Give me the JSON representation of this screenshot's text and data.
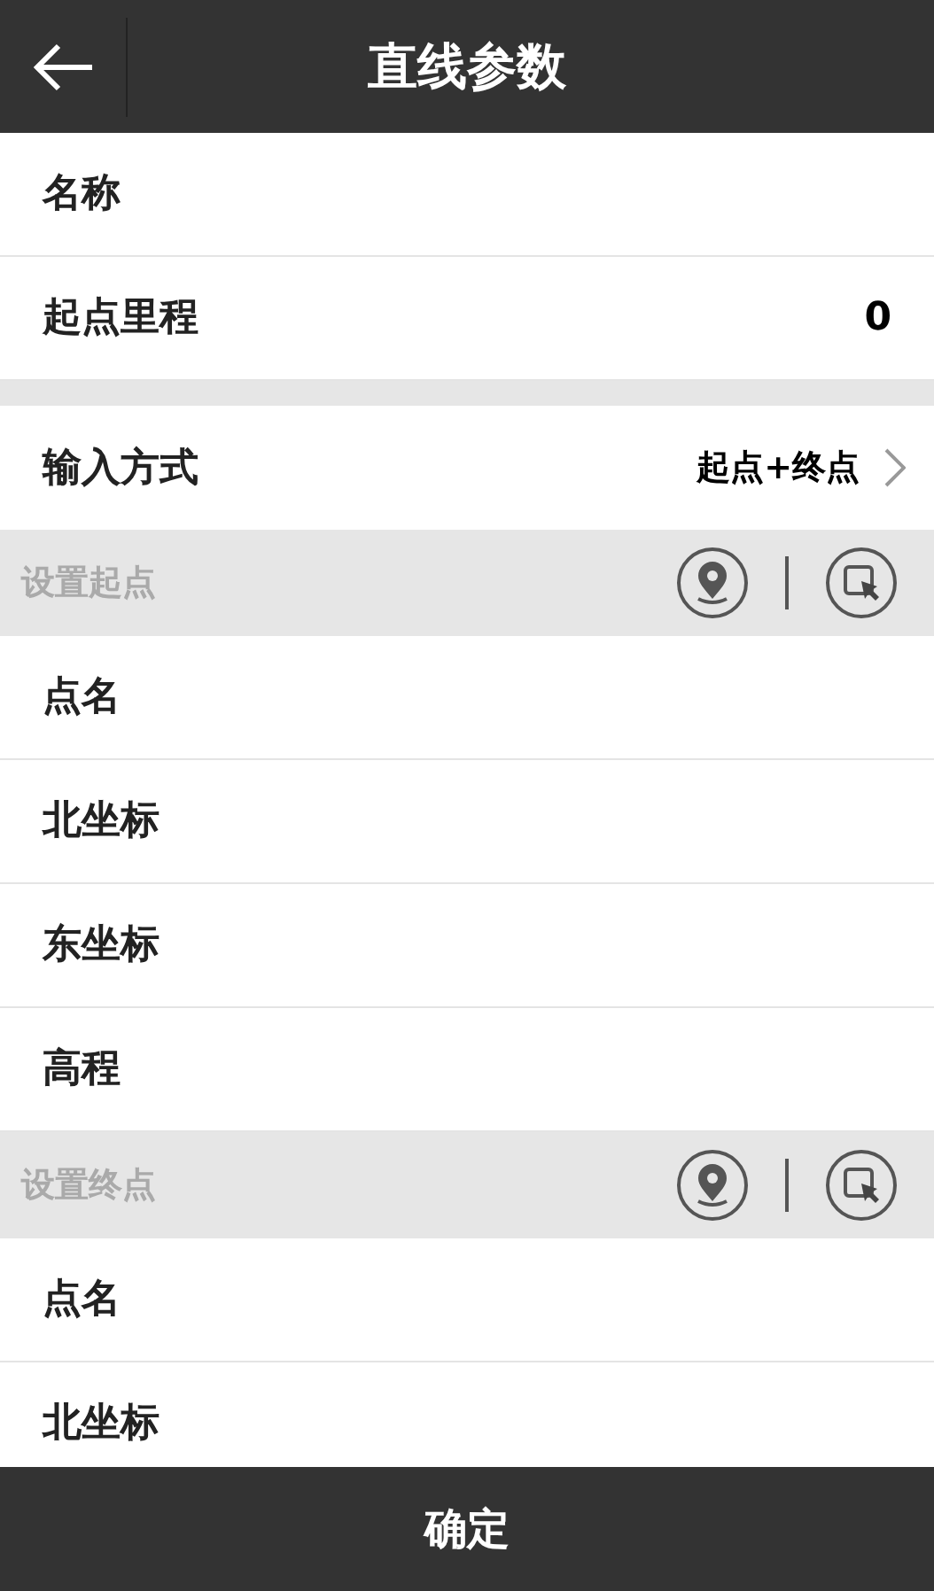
{
  "header": {
    "title": "直线参数"
  },
  "items": [
    {
      "kind": "field",
      "label": "名称"
    },
    {
      "kind": "field",
      "label": "起点里程",
      "value": "0"
    },
    {
      "kind": "gap"
    },
    {
      "kind": "select",
      "label": "输入方式",
      "value": "起点+终点"
    },
    {
      "kind": "section",
      "label": "设置起点"
    },
    {
      "kind": "field",
      "label": "点名"
    },
    {
      "kind": "field",
      "label": "北坐标"
    },
    {
      "kind": "field",
      "label": "东坐标"
    },
    {
      "kind": "field",
      "label": "高程"
    },
    {
      "kind": "section",
      "label": "设置终点"
    },
    {
      "kind": "field",
      "label": "点名"
    },
    {
      "kind": "field",
      "label": "北坐标"
    }
  ],
  "footer": {
    "button": "确定"
  }
}
